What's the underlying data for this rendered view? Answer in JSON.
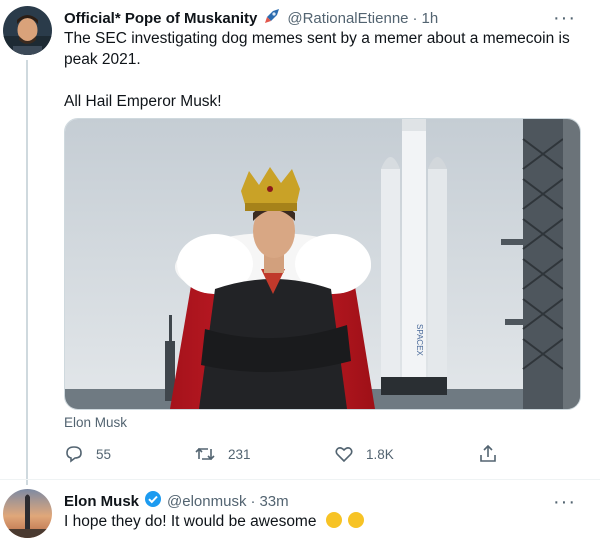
{
  "tweet1": {
    "name": "Official* Pope of Muskanity",
    "name_emoji": "rocket-icon",
    "handle": "@RationalEtienne",
    "separator": "·",
    "time": "1h",
    "text_line1": "The SEC investigating dog memes sent by a memer about a memecoin is",
    "text_line2": "peak 2021.",
    "text_line3": "All Hail Emperor Musk!",
    "media_caption": "Elon Musk",
    "media_rocket_text": "SPACEX",
    "replies": "55",
    "retweets": "231",
    "likes": "1.8K"
  },
  "tweet2": {
    "name": "Elon Musk",
    "handle": "@elonmusk",
    "separator": "·",
    "time": "33m",
    "text": "I hope they do! It would be awesome",
    "emoji": "rolling-on-floor-laughing-icon"
  },
  "colors": {
    "text": "#0f1419",
    "secondary": "#536471",
    "verified": "#1d9bf0",
    "thread_line": "#cfd9de"
  }
}
